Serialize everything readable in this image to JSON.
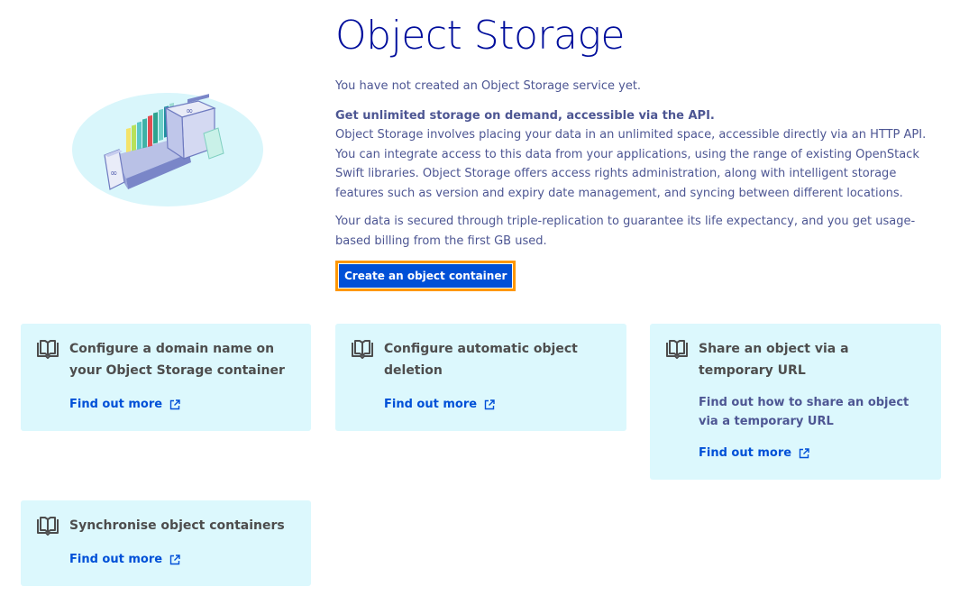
{
  "header": {
    "title": "Object Storage"
  },
  "intro": {
    "status": "You have not created an Object Storage service yet.",
    "lead": "Get unlimited storage on demand, accessible via the API.",
    "description": "Object Storage involves placing your data in an unlimited space, accessible directly via an HTTP API. You can integrate access to this data from your applications, using the range of existing OpenStack Swift libraries. Object Storage offers access rights administration, along with intelligent storage features such as version and expiry date management, and syncing between different locations.",
    "security": "Your data is secured through triple-replication to guarantee its life expectancy, and you get usage-based billing from the first GB used."
  },
  "actions": {
    "create_label": "Create an object container"
  },
  "guides": [
    {
      "title": "Configure a domain name on your Object Storage container",
      "description": "",
      "link_label": "Find out more",
      "icon": "book-icon"
    },
    {
      "title": "Configure automatic object deletion",
      "description": "",
      "link_label": "Find out more",
      "icon": "book-icon"
    },
    {
      "title": "Share an object via a temporary URL",
      "description": "Find out how to share an object via a temporary URL",
      "link_label": "Find out more",
      "icon": "book-icon"
    },
    {
      "title": "Synchronise object containers",
      "description": "",
      "link_label": "Find out more",
      "icon": "book-icon"
    }
  ],
  "colors": {
    "title": "#000e9c",
    "text": "#4d5693",
    "primary_button": "#0050d7",
    "focus_outline": "#ff9803",
    "card_background": "#dcf8fd",
    "link": "#0050d7"
  }
}
